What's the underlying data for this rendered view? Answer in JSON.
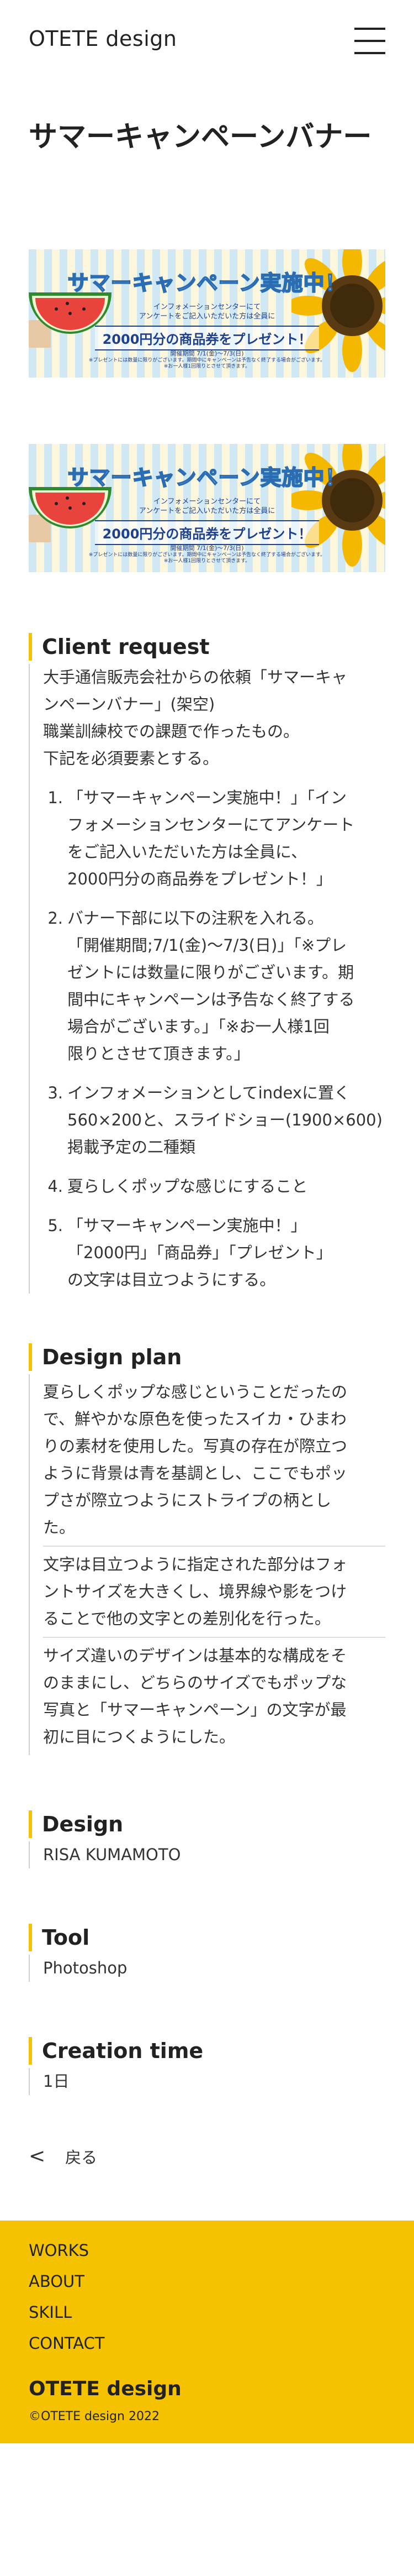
{
  "header": {
    "brand": "OTETE design"
  },
  "page_title": "サマーキャンペーンバナー",
  "banner": {
    "title": "サマーキャンペーン実施中！",
    "info_line1": "インフォメーションセンターにて",
    "info_line2": "アンケートをご記入いただいた方は全員に",
    "gift": "2000円分の商品券をプレゼント！",
    "date": "開催期間 7/1(金)〜7/3(日)",
    "note_line1": "※プレゼントには数量に限りがございます。期間中にキャンペーンは予告なく終了する場合がございます。",
    "note_line2": "※お一人様1回限りとさせて頂きます。"
  },
  "client_request": {
    "heading": "Client request",
    "intro": [
      "大手通信販売会社からの依頼「サマーキャ",
      "ンペーンバナー」(架空)",
      "職業訓練校での課題で作ったもの。",
      "下記を必須要素とする。"
    ],
    "items": [
      {
        "num": "1.",
        "lines": [
          "「サマーキャンペーン実施中！」「イン",
          "フォメーションセンターにてアンケート",
          "をご記入いただいた方は全員に、",
          "2000円分の商品券をプレゼント！」"
        ]
      },
      {
        "num": "2.",
        "lines": [
          "バナー下部に以下の注釈を入れる。",
          "「開催期間;7/1(金)〜7/3(日)」「※プレ",
          "ゼントには数量に限りがございます。期",
          "間中にキャンペーンは予告なく終了する",
          "場合がございます。」「※お一人様1回",
          "限りとさせて頂きます。」"
        ]
      },
      {
        "num": "3.",
        "lines": [
          "インフォメーションとしてindexに置く",
          "560×200と、スライドショー(1900×600)",
          "掲載予定の二種類"
        ]
      },
      {
        "num": "4.",
        "lines": [
          "夏らしくポップな感じにすること"
        ]
      },
      {
        "num": "5.",
        "lines": [
          "「サマーキャンペーン実施中！」",
          "「2000円」「商品券」「プレゼント」",
          "の文字は目立つようにする。"
        ]
      }
    ]
  },
  "design_plan": {
    "heading": "Design plan",
    "paragraphs": [
      [
        "夏らしくポップな感じということだったの",
        "で、鮮やかな原色を使ったスイカ・ひまわ",
        "りの素材を使用した。写真の存在が際立つ",
        "ように背景は青を基調とし、ここでもポッ",
        "プさが際立つようにストライプの柄とし",
        "た。"
      ],
      [
        "文字は目立つように指定された部分はフォ",
        "ントサイズを大きくし、境界線や影をつけ",
        "ることで他の文字との差別化を行った。"
      ],
      [
        "サイズ違いのデザインは基本的な構成をそ",
        "のままにし、どちらのサイズでもポップな",
        "写真と「サマーキャンペーン」の文字が最",
        "初に目につくようにした。"
      ]
    ]
  },
  "design": {
    "heading": "Design",
    "value": "RISA KUMAMOTO"
  },
  "tool": {
    "heading": "Tool",
    "value": "Photoshop"
  },
  "creation_time": {
    "heading": "Creation time",
    "value": "1日"
  },
  "back": {
    "icon": "chevron-left-icon",
    "label": "戻る"
  },
  "footer": {
    "links": [
      "WORKS",
      "ABOUT",
      "SKILL",
      "CONTACT"
    ],
    "brand": "OTETE design",
    "copyright": "©OTETE design 2022"
  },
  "colors": {
    "accent": "#f5c200",
    "text": "#222222",
    "banner_blue": "#2a6db3"
  }
}
